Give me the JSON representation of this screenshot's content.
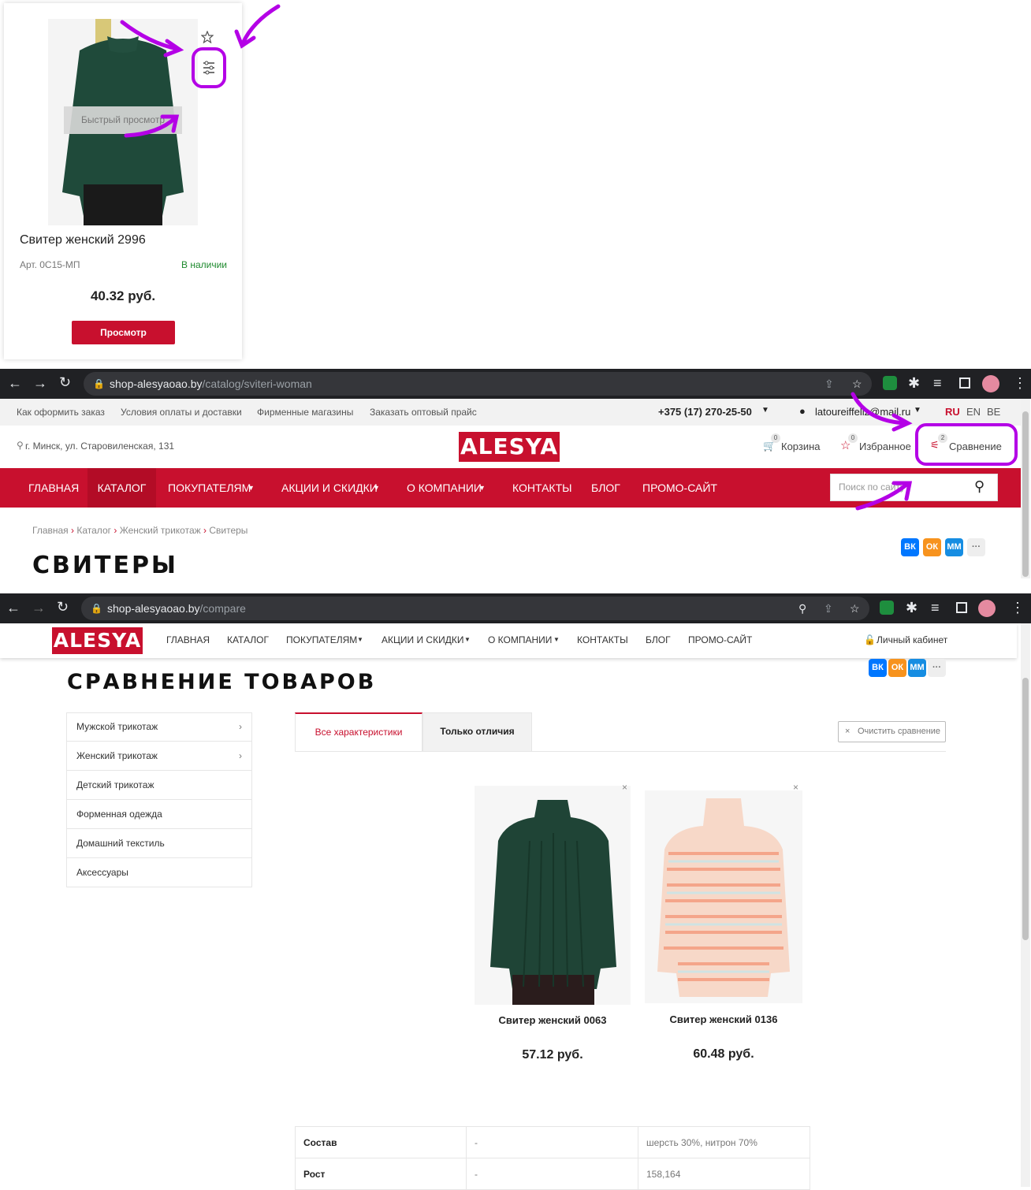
{
  "card": {
    "quick_view": "Быстрый просмотр",
    "title": "Свитер женский 2996",
    "article": "Арт. 0С15-МП",
    "stock": "В наличии",
    "price": "40.32 руб.",
    "view_button": "Просмотр"
  },
  "browser1": {
    "host": "shop-alesyaoao.by",
    "path": "/catalog/sviteri-woman"
  },
  "topbar": {
    "links": [
      "Как оформить заказ",
      "Условия оплаты и доставки",
      "Фирменные магазины",
      "Заказать оптовый прайс"
    ],
    "phone": "+375 (17) 270-25-50",
    "email": "latoureiffeliz@mail.ru",
    "langs": [
      "RU",
      "EN",
      "BE"
    ]
  },
  "header": {
    "address": "г. Минск, ул. Старовиленская, 131",
    "logo": "ALESYA",
    "cart_label": "Корзина",
    "cart_count": "0",
    "fav_label": "Избранное",
    "fav_count": "0",
    "compare_label": "Сравнение",
    "compare_count": "2"
  },
  "nav": {
    "items": [
      "ГЛАВНАЯ",
      "КАТАЛОГ",
      "ПОКУПАТЕЛЯМ",
      "АКЦИИ И СКИДКИ",
      "О КОМПАНИИ",
      "КОНТАКТЫ",
      "БЛОГ",
      "ПРОМО-САЙТ"
    ],
    "search_placeholder": "Поиск по сайту"
  },
  "breadcrumb": [
    "Главная",
    "Каталог",
    "Женский трикотаж",
    "Свитеры"
  ],
  "catalog_title": "СВИТЕРЫ",
  "social": [
    "ВК",
    "ОК",
    "ММ",
    "···"
  ],
  "browser2": {
    "host": "shop-alesyaoao.by",
    "path": "/compare"
  },
  "nav3": {
    "items": [
      "ГЛАВНАЯ",
      "КАТАЛОГ",
      "ПОКУПАТЕЛЯМ",
      "АКЦИИ И СКИДКИ",
      "О КОМПАНИИ",
      "КОНТАКТЫ",
      "БЛОГ",
      "ПРОМО-САЙТ"
    ],
    "account": "Личный кабинет"
  },
  "compare": {
    "title": "СРАВНЕНИЕ ТОВАРОВ",
    "sidebar": [
      "Мужской трикотаж",
      "Женский трикотаж",
      "Детский трикотаж",
      "Форменная одежда",
      "Домашний текстиль",
      "Аксессуары"
    ],
    "tab_all": "Все характеристики",
    "tab_diff": "Только отличия",
    "clear_button": "Очистить сравнение",
    "products": [
      {
        "name": "Свитер женский 0063",
        "price": "57.12 руб."
      },
      {
        "name": "Свитер женский 0136",
        "price": "60.48 руб."
      }
    ],
    "rows": [
      {
        "label": "Состав",
        "v1": "-",
        "v2": "шерсть 30%, нитрон 70%"
      },
      {
        "label": "Рост",
        "v1": "-",
        "v2": "158,164"
      }
    ]
  },
  "colors": {
    "brand_red": "#c8102e",
    "annotation_purple": "#b400e6",
    "in_stock_green": "#1e8a2e"
  }
}
